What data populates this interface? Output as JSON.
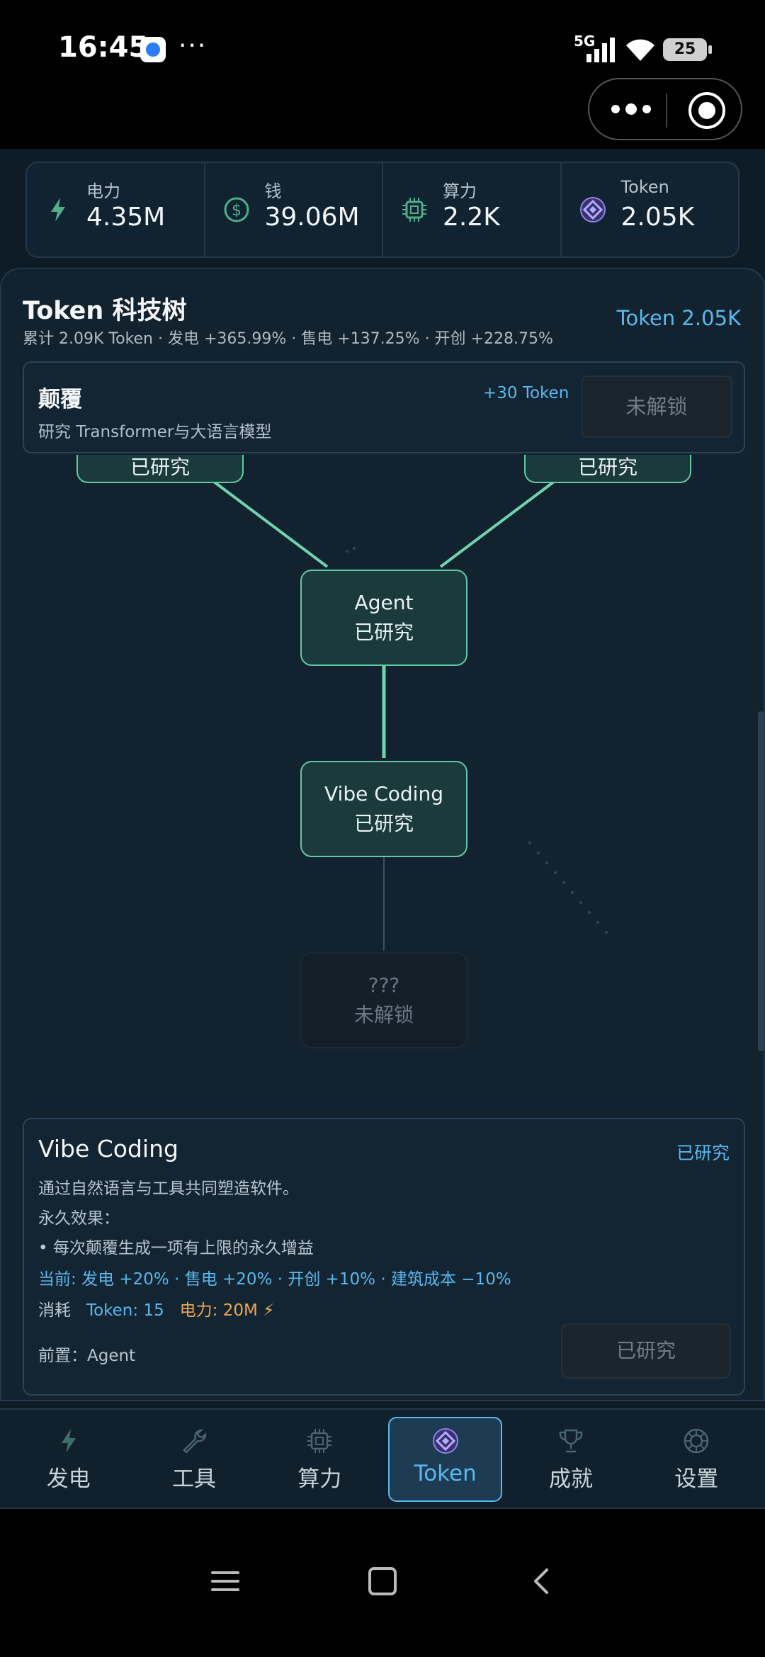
{
  "status_bar": {
    "time": "16:45",
    "network": "5G",
    "battery": "25",
    "menu_dots": "···"
  },
  "resources": [
    {
      "label": "电力",
      "value": "4.35M",
      "icon": "lightning-icon"
    },
    {
      "label": "钱",
      "value": "39.06M",
      "icon": "dollar-icon"
    },
    {
      "label": "算力",
      "value": "2.2K",
      "icon": "chip-icon"
    },
    {
      "label": "Token",
      "value": "2.05K",
      "icon": "token-icon"
    }
  ],
  "panel": {
    "title": "Token 科技树",
    "token_label": "Token  2.05K",
    "summary": "累计 2.09K Token · 发电 +365.99% · 售电 +137.25% · 开创 +228.75%"
  },
  "next_research": {
    "title": "颠覆",
    "description": "研究 Transformer与大语言模型",
    "reward": "+30 Token",
    "button": "未解锁"
  },
  "tree_nodes": [
    {
      "name": "",
      "status": "已研究"
    },
    {
      "name": "",
      "status": "已研究"
    },
    {
      "name": "Agent",
      "status": "已研究"
    },
    {
      "name": "Vibe Coding",
      "status": "已研究"
    },
    {
      "name": "???",
      "status": "未解锁"
    }
  ],
  "detail": {
    "name": "Vibe Coding",
    "status": "已研究",
    "description": "通过自然语言与工具共同塑造软件。",
    "effects_title": "永久效果：",
    "effect_item": "• 每次颠覆生成一项有上限的永久增益",
    "current_label": "当前:",
    "current_value": "发电 +20% · 售电 +20% · 开创 +10% · 建筑成本 −10%",
    "cost_label": "消耗",
    "cost_token": "Token: 15",
    "cost_power": "电力: 20M ⚡",
    "prereq": "前置：Agent",
    "button": "已研究"
  },
  "nav": [
    {
      "label": "发电",
      "icon": "lightning-icon"
    },
    {
      "label": "工具",
      "icon": "wrench-icon"
    },
    {
      "label": "算力",
      "icon": "chip-icon"
    },
    {
      "label": "Token",
      "icon": "token-icon",
      "active": true
    },
    {
      "label": "成就",
      "icon": "trophy-icon"
    },
    {
      "label": "设置",
      "icon": "gear-icon"
    }
  ],
  "colors": {
    "accent": "#5ab8ec",
    "node_border": "#5fc9a4",
    "background": "#12222f",
    "cost_power": "#f2a54a"
  }
}
